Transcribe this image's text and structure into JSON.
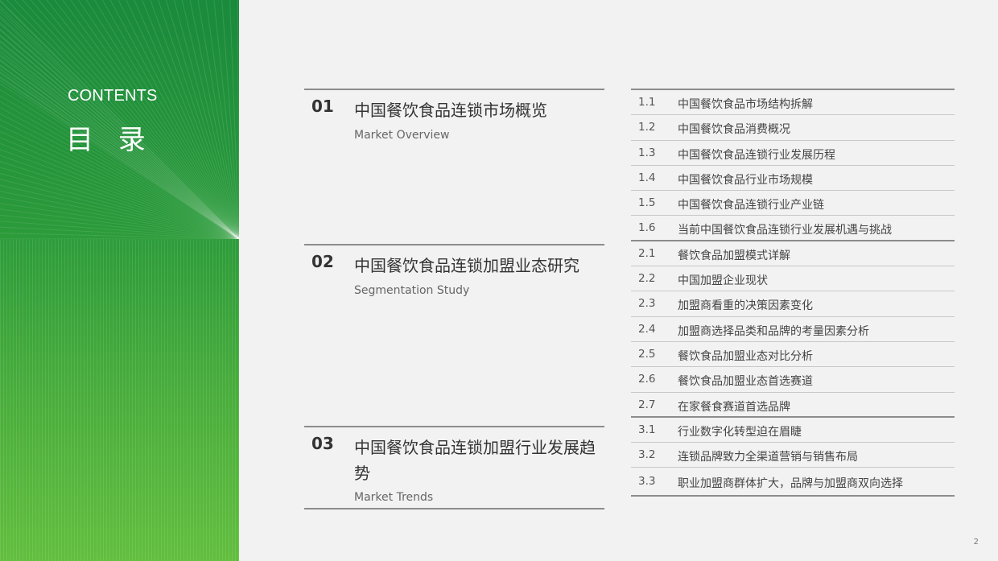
{
  "sidebar": {
    "contents_label": "CONTENTS",
    "title": "目 录",
    "colors": {
      "top": "#1a8a3c",
      "bottom": "#62be3e"
    }
  },
  "sections": [
    {
      "number": "01",
      "title": "中国餐饮食品连锁市场概览",
      "subtitle": "Market Overview"
    },
    {
      "number": "02",
      "title": "中国餐饮食品连锁加盟业态研究",
      "subtitle": "Segmentation Study"
    },
    {
      "number": "03",
      "title": "中国餐饮食品连锁加盟行业发展趋势",
      "subtitle": "Market Trends"
    }
  ],
  "items": [
    {
      "number": "1.1",
      "text": "中国餐饮食品市场结构拆解"
    },
    {
      "number": "1.2",
      "text": "中国餐饮食品消费概况"
    },
    {
      "number": "1.3",
      "text": "中国餐饮食品连锁行业发展历程"
    },
    {
      "number": "1.4",
      "text": "中国餐饮食品行业市场规模"
    },
    {
      "number": "1.5",
      "text": "中国餐饮食品连锁行业产业链"
    },
    {
      "number": "1.6",
      "text": "当前中国餐饮食品连锁行业发展机遇与挑战"
    },
    {
      "number": "2.1",
      "text": "餐饮食品加盟模式详解"
    },
    {
      "number": "2.2",
      "text": "中国加盟企业现状"
    },
    {
      "number": "2.3",
      "text": "加盟商看重的决策因素变化"
    },
    {
      "number": "2.4",
      "text": "加盟商选择品类和品牌的考量因素分析"
    },
    {
      "number": "2.5",
      "text": "餐饮食品加盟业态对比分析"
    },
    {
      "number": "2.6",
      "text": "餐饮食品加盟业态首选赛道"
    },
    {
      "number": "2.7",
      "text": "在家餐食赛道首选品牌"
    },
    {
      "number": "3.1",
      "text": "行业数字化转型迫在眉睫"
    },
    {
      "number": "3.2",
      "text": "连锁品牌致力全渠道营销与销售布局"
    },
    {
      "number": "3.3",
      "text": "职业加盟商群体扩大，品牌与加盟商双向选择"
    }
  ],
  "page_number": "2"
}
